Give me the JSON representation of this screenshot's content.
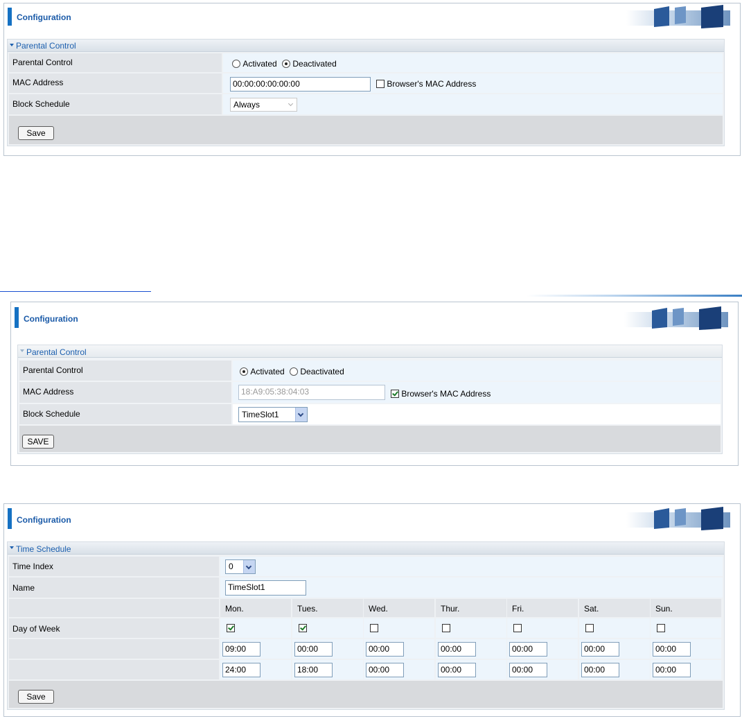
{
  "panel1": {
    "header_title": "Configuration",
    "section_title": "Parental Control",
    "parental_control_label": "Parental Control",
    "activated_label": "Activated",
    "deactivated_label": "Deactivated",
    "selected": "Deactivated",
    "mac_label": "MAC Address",
    "mac_value": "00:00:00:00:00:00",
    "browser_mac_label": "Browser's MAC Address",
    "browser_mac_checked": false,
    "schedule_label": "Block Schedule",
    "schedule_value": "Always",
    "save_label": "Save"
  },
  "panel2": {
    "header_title": "Configuration",
    "section_title": "Parental Control",
    "parental_control_label": "Parental Control",
    "activated_label": "Activated",
    "deactivated_label": "Deactivated",
    "selected": "Activated",
    "mac_label": "MAC Address",
    "mac_value": "18:A9:05:38:04:03",
    "browser_mac_label": "Browser's MAC Address",
    "browser_mac_checked": true,
    "schedule_label": "Block Schedule",
    "schedule_value": "TimeSlot1",
    "save_label": "SAVE"
  },
  "panel3": {
    "header_title": "Configuration",
    "section_title": "Time Schedule",
    "time_index_label": "Time Index",
    "time_index_value": "0",
    "name_label": "Name",
    "name_value": "TimeSlot1",
    "day_of_week_label": "Day of Week",
    "days": [
      {
        "label": "Mon.",
        "checked": true,
        "start": "09:00",
        "end": "24:00"
      },
      {
        "label": "Tues.",
        "checked": true,
        "start": "00:00",
        "end": "18:00"
      },
      {
        "label": "Wed.",
        "checked": false,
        "start": "00:00",
        "end": "00:00"
      },
      {
        "label": "Thur.",
        "checked": false,
        "start": "00:00",
        "end": "00:00"
      },
      {
        "label": "Fri.",
        "checked": false,
        "start": "00:00",
        "end": "00:00"
      },
      {
        "label": "Sat.",
        "checked": false,
        "start": "00:00",
        "end": "00:00"
      },
      {
        "label": "Sun.",
        "checked": false,
        "start": "00:00",
        "end": "00:00"
      }
    ],
    "save_label": "Save"
  },
  "colors": {
    "accent": "#1571c3",
    "title_text": "#1a5aa8",
    "label_bg": "#e2e5e9",
    "value_bg": "#edf5fc"
  }
}
